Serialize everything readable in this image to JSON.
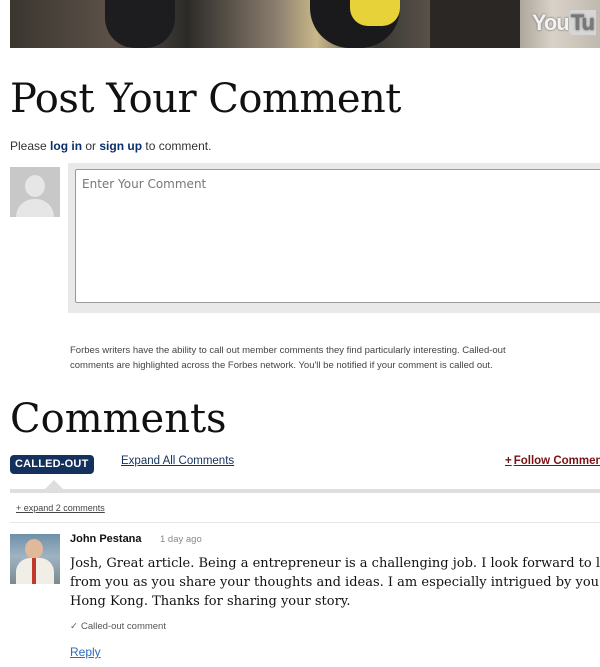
{
  "video": {
    "logo_text": "You",
    "logo_tube": "Tu"
  },
  "post_comment": {
    "title": "Post Your Comment",
    "login_prefix": "Please ",
    "login_link": "log in",
    "login_middle": " or ",
    "signup_link": "sign up",
    "login_suffix": " to comment.",
    "placeholder": "Enter Your Comment",
    "note_line1": "Forbes writers have the ability to call out member comments they find particularly interesting. Called-out",
    "note_line2": "comments are highlighted across the Forbes network. You'll be notified if your comment is called out."
  },
  "comments": {
    "title": "Comments",
    "badge": "CALLED-OUT",
    "expand_all": "Expand All Comments",
    "follow_plus": "+",
    "follow_label": "Follow Comments",
    "expand_two": "+ expand 2 comments",
    "items": [
      {
        "author": "John Pestana",
        "time": "1 day ago",
        "lines": [
          "Josh, Great article. Being a entrepreneur is a challenging job. I look forward to learning",
          "from you as you share your thoughts and ideas. I am especially intrigued by you moving to",
          "Hong Kong. Thanks for sharing your story."
        ],
        "status": "Called-out comment",
        "reply": "Reply"
      }
    ]
  },
  "colors": {
    "badge_bg": "#13315c",
    "link_blue": "#0b2e6b",
    "follow_red": "#7a1414",
    "reply_blue": "#2a6ebb"
  }
}
